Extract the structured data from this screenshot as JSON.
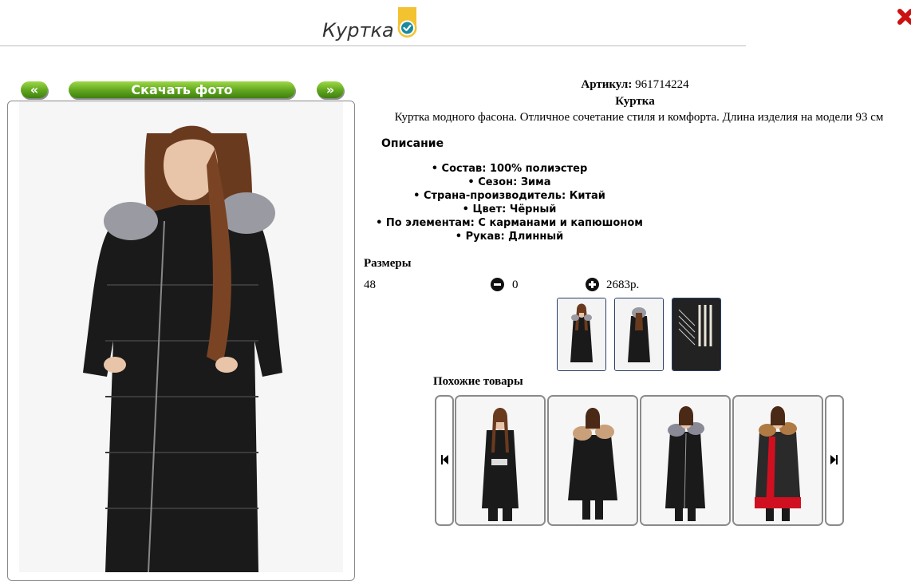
{
  "header": {
    "title": "Куртка"
  },
  "nav": {
    "prev_label": "«",
    "download_label": "Скачать фото",
    "next_label": "»"
  },
  "product": {
    "sku_label": "Артикул:",
    "sku_value": "961714224",
    "name": "Куртка",
    "description": "Куртка модного фасона. Отличное сочетание стиля и комфорта. Длина изделия на модели 93 см",
    "desc_heading": "Описание",
    "specs": [
      "Состав: 100% полиэстер",
      "Сезон: Зима",
      "Страна-производитель: Китай",
      "Цвет: Чёрный",
      "По элементам: С карманами и капюшоном",
      "Рукав: Длинный"
    ]
  },
  "sizes": {
    "heading": "Размеры",
    "size": "48",
    "quantity": "0",
    "price": "2683р."
  },
  "similar": {
    "heading": "Похожие товары"
  },
  "icons": {
    "badge": "verified-check-icon",
    "close": "close-icon",
    "minus": "minus-circle-icon",
    "plus": "plus-circle-icon",
    "carousel_prev": "skip-back-icon",
    "carousel_next": "skip-forward-icon"
  },
  "colors": {
    "nav_green": "#5fa51d",
    "badge_gold": "#f2c230",
    "badge_teal": "#1a8aa0",
    "close_red": "#cc1111",
    "thumb_border": "#2a3f66",
    "jacket_black": "#1a1a1a",
    "accent_red": "#d01020"
  }
}
